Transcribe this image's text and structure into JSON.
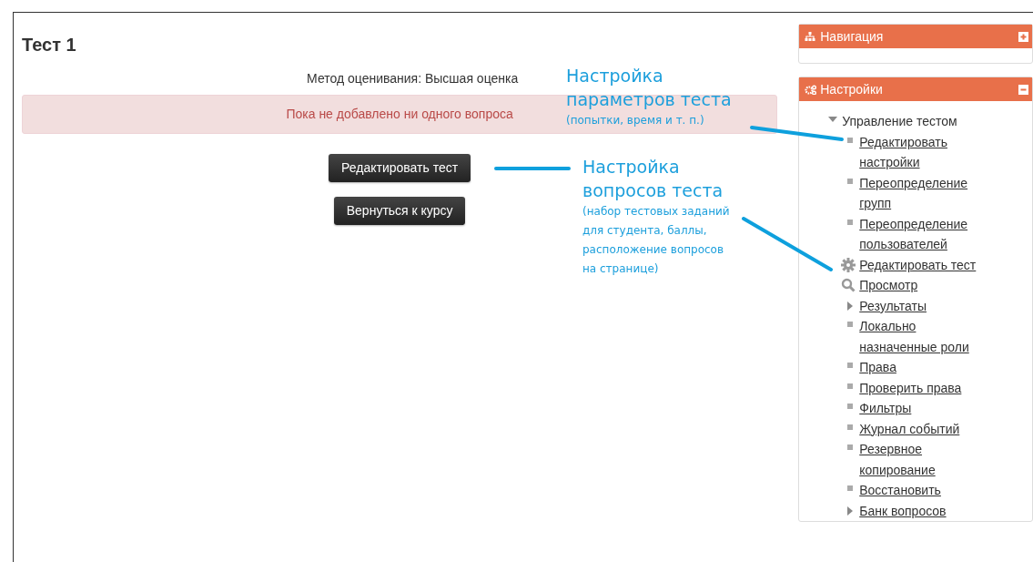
{
  "main": {
    "title": "Тест 1",
    "grading_method": "Метод оценивания: Высшая оценка",
    "alert": "Пока не добавлено ни одного вопроса",
    "buttons": [
      "Редактировать тест",
      "Вернуться к курсу"
    ]
  },
  "blocks": [
    {
      "title": "Навигация",
      "kind": "navigation",
      "expanded": false
    },
    {
      "title": "Настройки",
      "kind": "settings",
      "expanded": true,
      "items": [
        {
          "label": "Управление тестом",
          "kind": "branch",
          "expanded": true,
          "children": [
            {
              "label": "Редактировать настройки",
              "kind": "leaf"
            },
            {
              "label": "Переопределение групп",
              "kind": "leaf"
            },
            {
              "label": "Переопределение пользователей",
              "kind": "leaf"
            },
            {
              "label": "Редактировать тест",
              "kind": "gear"
            },
            {
              "label": "Просмотр",
              "kind": "search"
            },
            {
              "label": "Результаты",
              "kind": "branch",
              "expanded": false
            },
            {
              "label": "Локально назначенные роли",
              "kind": "leaf"
            },
            {
              "label": "Права",
              "kind": "leaf"
            },
            {
              "label": "Проверить права",
              "kind": "leaf"
            },
            {
              "label": "Фильтры",
              "kind": "leaf"
            },
            {
              "label": "Журнал событий",
              "kind": "leaf"
            },
            {
              "label": "Резервное копирование",
              "kind": "leaf"
            },
            {
              "label": "Восстановить",
              "kind": "leaf"
            },
            {
              "label": "Банк вопросов",
              "kind": "branch",
              "expanded": false
            }
          ]
        }
      ]
    }
  ],
  "annotations": [
    {
      "heading": "Настройка параметров теста",
      "note": "(попытки, время и т. п.)"
    },
    {
      "heading": "Настройка вопросов теста",
      "note": "(набор тестовых заданий для студента, баллы, расположение вопросов на странице)"
    }
  ]
}
